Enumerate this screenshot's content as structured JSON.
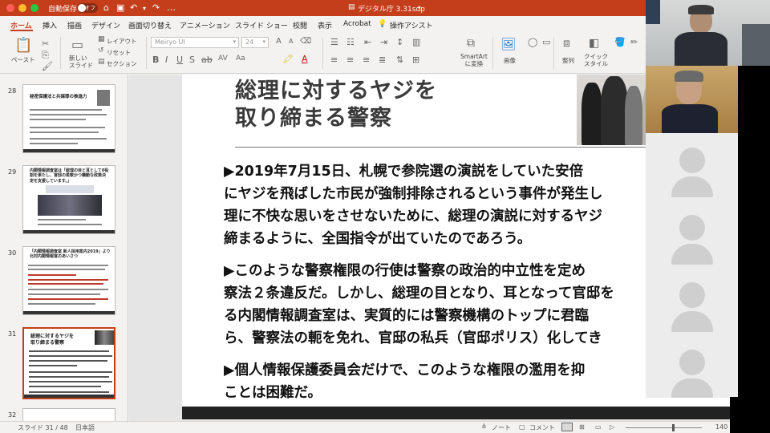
{
  "titlebar": {
    "autosave_label": "自動保存",
    "autosave_state": "オフ",
    "doc_title": "デジタル庁 3.31sdp"
  },
  "tabs": [
    {
      "label": "ホーム",
      "active": true
    },
    {
      "label": "挿入"
    },
    {
      "label": "描画"
    },
    {
      "label": "デザイン"
    },
    {
      "label": "画面切り替え"
    },
    {
      "label": "アニメーション"
    },
    {
      "label": "スライド ショー"
    },
    {
      "label": "校閲"
    },
    {
      "label": "表示"
    },
    {
      "label": "Acrobat"
    },
    {
      "label": "操作アシスト"
    }
  ],
  "ribbon": {
    "paste_label": "ペースト",
    "new_slide_label": "新しい\nスライド",
    "layout_label": "レイアウト",
    "reset_label": "リセット",
    "section_label": "セクション",
    "font_name": "Meiryo UI",
    "font_size": "24",
    "smartart_label": "SmartArt\nに変換",
    "image_label": "画像",
    "arrange_label": "整列",
    "quick_style_label": "クイック\nスタイル"
  },
  "thumbnails": [
    {
      "number": "28",
      "title": "秘密保護法と共謀罪の推進力"
    },
    {
      "number": "29",
      "title": "内閣情報調査室は「総理の目と耳として0役\n割を果たし、官邸の柔軟かつ機動な政策決\n定を支援しています。」"
    },
    {
      "number": "30",
      "title": "「内閣情報調査室 新人採用案内2019」より\n北村内閣情報官のあいさつ"
    },
    {
      "number": "31",
      "title": "総理に対するヤジを\n取り締まる警察",
      "selected": true
    },
    {
      "number": "32",
      "title": ""
    }
  ],
  "slide": {
    "title_line1": "総理に対するヤジを",
    "title_line2": "取り締まる警察",
    "lines": [
      "▶2019年7月15日、札幌で参院選の演説をしていた安倍",
      "にヤジを飛ばした市民が強制排除されるという事件が発生し",
      "理に不快な思いをさせないために、総理の演説に対するヤジ",
      "締まるように、全国指令が出ていたのであろう。",
      "▶このような警察権限の行使は警察の政治的中立性を定め",
      "察法２条違反だ。しかし、総理の目となり、耳となって官邸を",
      "る内閣情報調査室は、実質的には警察機構のトップに君臨",
      "ら、警察法の軛を免れ、官邸の私兵（官邸ポリス）化してき",
      "▶個人情報保護委員会だけで、このような権限の濫用を抑",
      "ことは困難だ。"
    ]
  },
  "status": {
    "slide_indicator": "スライド 31 / 48",
    "language": "日本語",
    "notes_label": "ノート",
    "comments_label": "コメント",
    "zoom": "140"
  },
  "colors": {
    "accent": "#c43e1c",
    "slide_text": "#111111",
    "title_text": "#3a3a3a"
  }
}
